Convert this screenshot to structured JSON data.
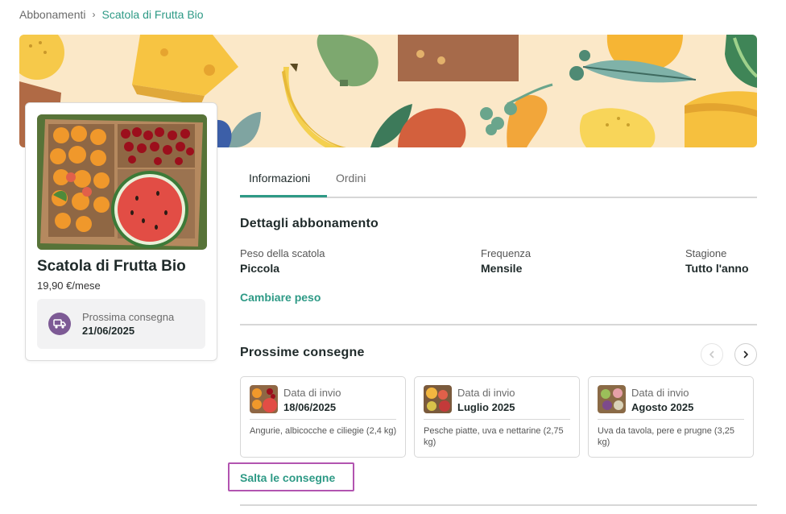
{
  "breadcrumb": {
    "parent": "Abbonamenti",
    "separator": "›",
    "current": "Scatola di Frutta Bio"
  },
  "product": {
    "name": "Scatola di Frutta Bio",
    "price": "19,90 €/mese",
    "next_delivery_label": "Prossima consegna",
    "next_delivery_date": "21/06/2025"
  },
  "tabs": [
    {
      "label": "Informazioni",
      "active": true
    },
    {
      "label": "Ordini",
      "active": false
    }
  ],
  "details": {
    "title": "Dettagli abbonamento",
    "fields": [
      {
        "label": "Peso della scatola",
        "value": "Piccola"
      },
      {
        "label": "Frequenza",
        "value": "Mensile"
      },
      {
        "label": "Stagione",
        "value": "Tutto l'anno"
      }
    ],
    "change_link": "Cambiare peso"
  },
  "deliveries": {
    "title": "Prossime consegne",
    "items": [
      {
        "label": "Data di invio",
        "date": "18/06/2025",
        "description": "Angurie, albicocche e ciliegie (2,4 kg)"
      },
      {
        "label": "Data di invio",
        "date": "Luglio 2025",
        "description": "Pesche piatte, uva e nettarine (2,75 kg)"
      },
      {
        "label": "Data di invio",
        "date": "Agosto 2025",
        "description": "Uva da tavola, pere e prugne (3,25 kg)"
      }
    ],
    "skip_link": "Salta le consegne"
  },
  "colors": {
    "accent": "#2e9a86",
    "truck_badge": "#7d5a95",
    "highlight": "#b254b0"
  }
}
